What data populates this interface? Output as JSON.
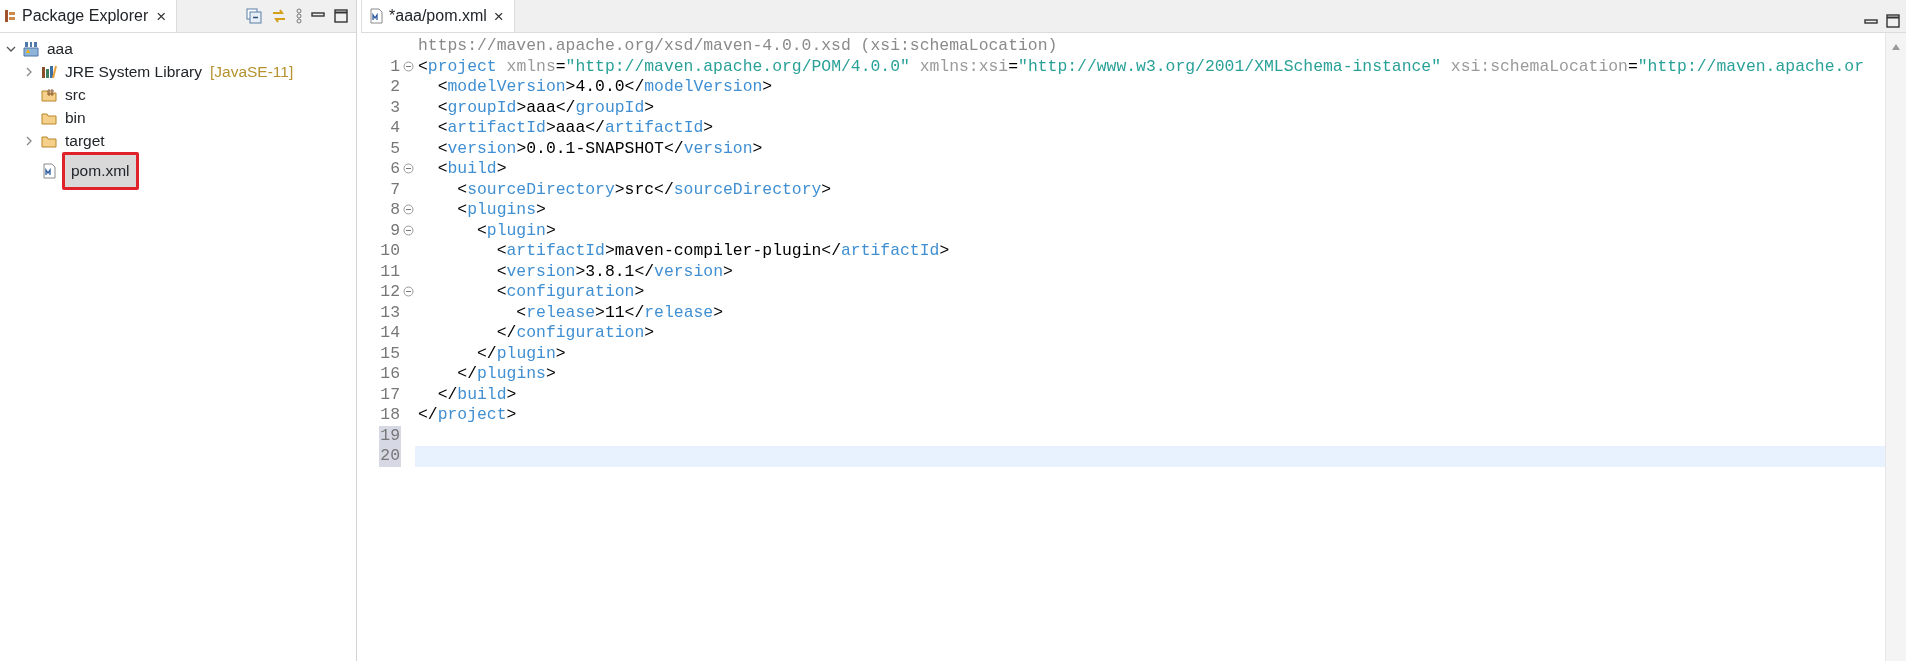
{
  "explorer": {
    "title": "Package Explorer",
    "close": "×",
    "tree": [
      {
        "label": "aaa",
        "kind": "project",
        "expanded": true,
        "selected": false,
        "highlighted": false,
        "children": [
          {
            "label": "JRE System Library",
            "decoration": "[JavaSE-11]",
            "kind": "library",
            "expanded": false,
            "selected": false,
            "highlighted": false
          },
          {
            "label": "src",
            "kind": "source-folder",
            "selected": false,
            "highlighted": false
          },
          {
            "label": "bin",
            "kind": "folder",
            "selected": false,
            "highlighted": false
          },
          {
            "label": "target",
            "kind": "folder",
            "expanded": false,
            "selected": false,
            "highlighted": false
          },
          {
            "label": "pom.xml",
            "kind": "xml-file",
            "selected": true,
            "highlighted": true
          }
        ]
      }
    ]
  },
  "editor": {
    "tabs": [
      {
        "label": "*aaa/pom.xml",
        "close": "×",
        "selected": true
      }
    ],
    "hover_hint": "https://maven.apache.org/xsd/maven-4.0.0.xsd (xsi:schemaLocation)",
    "lines": [
      {
        "number": "1",
        "foldable": true,
        "current": false,
        "marked": false,
        "tokens": [
          {
            "kind": "punct",
            "text": "<"
          },
          {
            "kind": "tag",
            "text": "project"
          },
          {
            "kind": "attr",
            "text": " xmlns"
          },
          {
            "kind": "punct",
            "text": "="
          },
          {
            "kind": "value",
            "text": "\"http://maven.apache.org/POM/4.0.0\""
          },
          {
            "kind": "attr",
            "text": " xmlns:xsi"
          },
          {
            "kind": "punct",
            "text": "="
          },
          {
            "kind": "value",
            "text": "\"http://www.w3.org/2001/XMLSchema-instance\""
          },
          {
            "kind": "attr",
            "text": " xsi:schemaLocation"
          },
          {
            "kind": "punct",
            "text": "="
          },
          {
            "kind": "value",
            "text": "\"http://maven.apache.or"
          }
        ]
      },
      {
        "number": "2",
        "foldable": false,
        "current": false,
        "marked": false,
        "tokens": [
          {
            "kind": "punct",
            "text": "  <"
          },
          {
            "kind": "tag",
            "text": "modelVersion"
          },
          {
            "kind": "punct",
            "text": ">"
          },
          {
            "kind": "text",
            "text": "4.0.0"
          },
          {
            "kind": "punct",
            "text": "</"
          },
          {
            "kind": "tag",
            "text": "modelVersion"
          },
          {
            "kind": "punct",
            "text": ">"
          }
        ]
      },
      {
        "number": "3",
        "foldable": false,
        "current": false,
        "marked": false,
        "tokens": [
          {
            "kind": "punct",
            "text": "  <"
          },
          {
            "kind": "tag",
            "text": "groupId"
          },
          {
            "kind": "punct",
            "text": ">"
          },
          {
            "kind": "text",
            "text": "aaa"
          },
          {
            "kind": "punct",
            "text": "</"
          },
          {
            "kind": "tag",
            "text": "groupId"
          },
          {
            "kind": "punct",
            "text": ">"
          }
        ]
      },
      {
        "number": "4",
        "foldable": false,
        "current": false,
        "marked": false,
        "tokens": [
          {
            "kind": "punct",
            "text": "  <"
          },
          {
            "kind": "tag",
            "text": "artifactId"
          },
          {
            "kind": "punct",
            "text": ">"
          },
          {
            "kind": "text",
            "text": "aaa"
          },
          {
            "kind": "punct",
            "text": "</"
          },
          {
            "kind": "tag",
            "text": "artifactId"
          },
          {
            "kind": "punct",
            "text": ">"
          }
        ]
      },
      {
        "number": "5",
        "foldable": false,
        "current": false,
        "marked": false,
        "tokens": [
          {
            "kind": "punct",
            "text": "  <"
          },
          {
            "kind": "tag",
            "text": "version"
          },
          {
            "kind": "punct",
            "text": ">"
          },
          {
            "kind": "text",
            "text": "0.0.1-SNAPSHOT"
          },
          {
            "kind": "punct",
            "text": "</"
          },
          {
            "kind": "tag",
            "text": "version"
          },
          {
            "kind": "punct",
            "text": ">"
          }
        ]
      },
      {
        "number": "6",
        "foldable": true,
        "current": false,
        "marked": false,
        "tokens": [
          {
            "kind": "punct",
            "text": "  <"
          },
          {
            "kind": "tag",
            "text": "build"
          },
          {
            "kind": "punct",
            "text": ">"
          }
        ]
      },
      {
        "number": "7",
        "foldable": false,
        "current": false,
        "marked": false,
        "tokens": [
          {
            "kind": "punct",
            "text": "    <"
          },
          {
            "kind": "tag",
            "text": "sourceDirectory"
          },
          {
            "kind": "punct",
            "text": ">"
          },
          {
            "kind": "text",
            "text": "src"
          },
          {
            "kind": "punct",
            "text": "</"
          },
          {
            "kind": "tag",
            "text": "sourceDirectory"
          },
          {
            "kind": "punct",
            "text": ">"
          }
        ]
      },
      {
        "number": "8",
        "foldable": true,
        "current": false,
        "marked": false,
        "tokens": [
          {
            "kind": "punct",
            "text": "    <"
          },
          {
            "kind": "tag",
            "text": "plugins"
          },
          {
            "kind": "punct",
            "text": ">"
          }
        ]
      },
      {
        "number": "9",
        "foldable": true,
        "current": false,
        "marked": false,
        "tokens": [
          {
            "kind": "punct",
            "text": "      <"
          },
          {
            "kind": "tag",
            "text": "plugin"
          },
          {
            "kind": "punct",
            "text": ">"
          }
        ]
      },
      {
        "number": "10",
        "foldable": false,
        "current": false,
        "marked": false,
        "tokens": [
          {
            "kind": "punct",
            "text": "        <"
          },
          {
            "kind": "tag",
            "text": "artifactId"
          },
          {
            "kind": "punct",
            "text": ">"
          },
          {
            "kind": "text",
            "text": "maven-compiler-plugin"
          },
          {
            "kind": "punct",
            "text": "</"
          },
          {
            "kind": "tag",
            "text": "artifactId"
          },
          {
            "kind": "punct",
            "text": ">"
          }
        ]
      },
      {
        "number": "11",
        "foldable": false,
        "current": false,
        "marked": false,
        "tokens": [
          {
            "kind": "punct",
            "text": "        <"
          },
          {
            "kind": "tag",
            "text": "version"
          },
          {
            "kind": "punct",
            "text": ">"
          },
          {
            "kind": "text",
            "text": "3.8.1"
          },
          {
            "kind": "punct",
            "text": "</"
          },
          {
            "kind": "tag",
            "text": "version"
          },
          {
            "kind": "punct",
            "text": ">"
          }
        ]
      },
      {
        "number": "12",
        "foldable": true,
        "current": false,
        "marked": false,
        "tokens": [
          {
            "kind": "punct",
            "text": "        <"
          },
          {
            "kind": "tag",
            "text": "configuration"
          },
          {
            "kind": "punct",
            "text": ">"
          }
        ]
      },
      {
        "number": "13",
        "foldable": false,
        "current": false,
        "marked": false,
        "tokens": [
          {
            "kind": "punct",
            "text": "          <"
          },
          {
            "kind": "tag",
            "text": "release"
          },
          {
            "kind": "punct",
            "text": ">"
          },
          {
            "kind": "text",
            "text": "11"
          },
          {
            "kind": "punct",
            "text": "</"
          },
          {
            "kind": "tag",
            "text": "release"
          },
          {
            "kind": "punct",
            "text": ">"
          }
        ]
      },
      {
        "number": "14",
        "foldable": false,
        "current": false,
        "marked": false,
        "tokens": [
          {
            "kind": "punct",
            "text": "        </"
          },
          {
            "kind": "tag",
            "text": "configuration"
          },
          {
            "kind": "punct",
            "text": ">"
          }
        ]
      },
      {
        "number": "15",
        "foldable": false,
        "current": false,
        "marked": false,
        "tokens": [
          {
            "kind": "punct",
            "text": "      </"
          },
          {
            "kind": "tag",
            "text": "plugin"
          },
          {
            "kind": "punct",
            "text": ">"
          }
        ]
      },
      {
        "number": "16",
        "foldable": false,
        "current": false,
        "marked": false,
        "tokens": [
          {
            "kind": "punct",
            "text": "    </"
          },
          {
            "kind": "tag",
            "text": "plugins"
          },
          {
            "kind": "punct",
            "text": ">"
          }
        ]
      },
      {
        "number": "17",
        "foldable": false,
        "current": false,
        "marked": false,
        "tokens": [
          {
            "kind": "punct",
            "text": "  </"
          },
          {
            "kind": "tag",
            "text": "build"
          },
          {
            "kind": "punct",
            "text": ">"
          }
        ]
      },
      {
        "number": "18",
        "foldable": false,
        "current": false,
        "marked": false,
        "tokens": [
          {
            "kind": "punct",
            "text": "</"
          },
          {
            "kind": "tag",
            "text": "project"
          },
          {
            "kind": "punct",
            "text": ">"
          }
        ]
      },
      {
        "number": "19",
        "foldable": false,
        "current": false,
        "marked": true
      },
      {
        "number": "20",
        "foldable": false,
        "current": true,
        "marked": true
      }
    ]
  }
}
